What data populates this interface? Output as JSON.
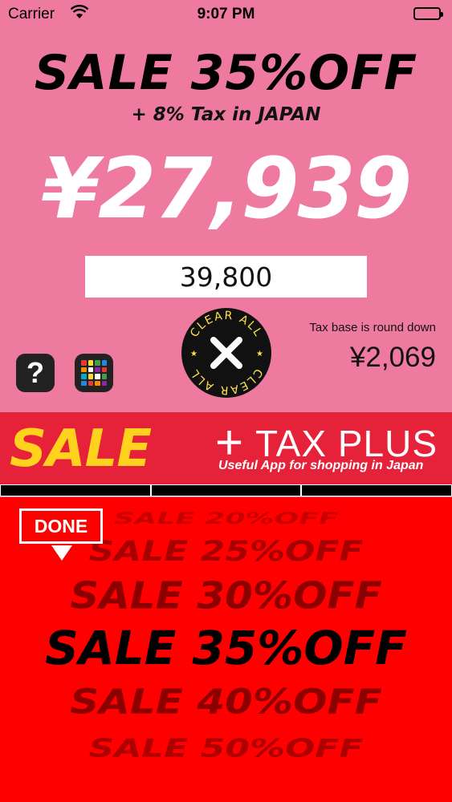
{
  "status_bar": {
    "carrier": "Carrier",
    "time": "9:07 PM"
  },
  "calculator": {
    "sale_title": "SALE 35%OFF",
    "tax_note": "+ 8% Tax in JAPAN",
    "result_price": "¥27,939",
    "price_input_value": "39,800",
    "tax_base_label": "Tax base is round down",
    "tax_amount": "¥2,069",
    "help_label": "?",
    "clear_text_top": "CLEAR ALL",
    "clear_text_bottom": "CLEAR ALL"
  },
  "banner": {
    "sale": "SALE",
    "plus": "+",
    "title": "TAX PLUS",
    "subtitle": "Useful App for shopping in Japan"
  },
  "picker": {
    "done_label": "DONE",
    "options": [
      "SALE 20%OFF",
      "SALE 25%OFF",
      "SALE 30%OFF",
      "SALE 35%OFF",
      "SALE 40%OFF",
      "SALE 50%OFF"
    ],
    "selected": "SALE 35%OFF"
  },
  "colors": {
    "background": "#ee7aa0",
    "banner": "#e6223a",
    "banner_sale": "#ffd21e",
    "picker": "#ff0000"
  },
  "icons": {
    "wifi": "wifi-icon",
    "battery": "battery-icon",
    "help": "help-icon",
    "apps": "apps-grid-icon",
    "clear": "close-icon"
  }
}
